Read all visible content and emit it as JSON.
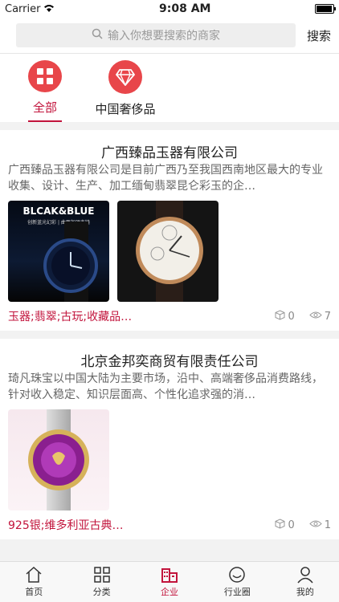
{
  "status": {
    "carrier": "Carrier",
    "time": "9:08 AM"
  },
  "search": {
    "placeholder": "输入你想要搜索的商家",
    "button": "搜索"
  },
  "categories": [
    {
      "label": "全部",
      "icon": "grid-icon"
    },
    {
      "label": "中国奢侈品",
      "icon": "diamond-icon"
    }
  ],
  "cards": [
    {
      "title": "广西臻品玉器有限公司",
      "desc": "广西臻品玉器有限公司是目前广西乃至我国西南地区最大的专业收集、设计、生产、加工缅甸翡翠昆仑彩玉的企…",
      "img_text": "BLCAK&BLUE",
      "img_sub": "创新蓝光幻彩 | 曲面加硬表镜",
      "tags": "玉器;翡翠;古玩;收藏品…",
      "comments": "0",
      "views": "7"
    },
    {
      "title": "北京金邦奕商贸有限责任公司",
      "desc": "琦凡珠宝以中国大陆为主要市场，沿中、高端奢侈品消费路线，针对收入稳定、知识层面高、个性化追求强的消…",
      "tags": "925银;维多利亚古典…",
      "comments": "0",
      "views": "1"
    }
  ],
  "tabs": [
    {
      "label": "首页"
    },
    {
      "label": "分类"
    },
    {
      "label": "企业"
    },
    {
      "label": "行业圈"
    },
    {
      "label": "我的"
    }
  ],
  "colors": {
    "accent": "#c2143c",
    "icon_bg": "#e8464a"
  }
}
